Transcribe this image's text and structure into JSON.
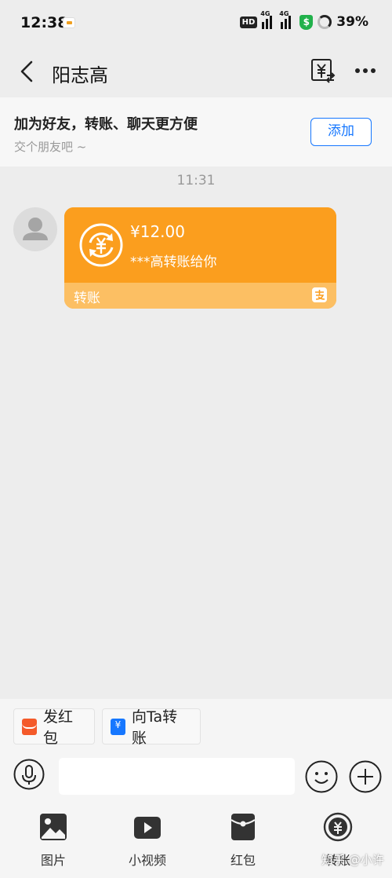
{
  "status_bar": {
    "time": "12:38",
    "network_badge": "HD",
    "signal_1_label": "4G",
    "signal_2_label": "4G",
    "battery": "39%"
  },
  "header": {
    "contact_name": "阳志高"
  },
  "banner": {
    "title": "加为好友，转账、聊天更方便",
    "subtitle": "交个朋友吧 ~",
    "add_label": "添加"
  },
  "chat": {
    "timestamp": "11:31",
    "message": {
      "amount": "¥12.00",
      "note": "***高转账给你",
      "type_label": "转账"
    }
  },
  "quick_actions": [
    {
      "label": "发红包"
    },
    {
      "label": "向Ta转账"
    }
  ],
  "input": {
    "placeholder": "",
    "value": ""
  },
  "toolbar": [
    {
      "label": "图片",
      "icon": "image-icon"
    },
    {
      "label": "小视频",
      "icon": "video-icon"
    },
    {
      "label": "红包",
      "icon": "red-packet-icon"
    },
    {
      "label": "转账",
      "icon": "transfer-coin-icon"
    }
  ],
  "watermark": "知乎 @小许",
  "colors": {
    "accent_blue": "#1677ff",
    "transfer_orange": "#fb9e1e",
    "transfer_orange_light": "#fcbf63",
    "background": "#ededed"
  }
}
